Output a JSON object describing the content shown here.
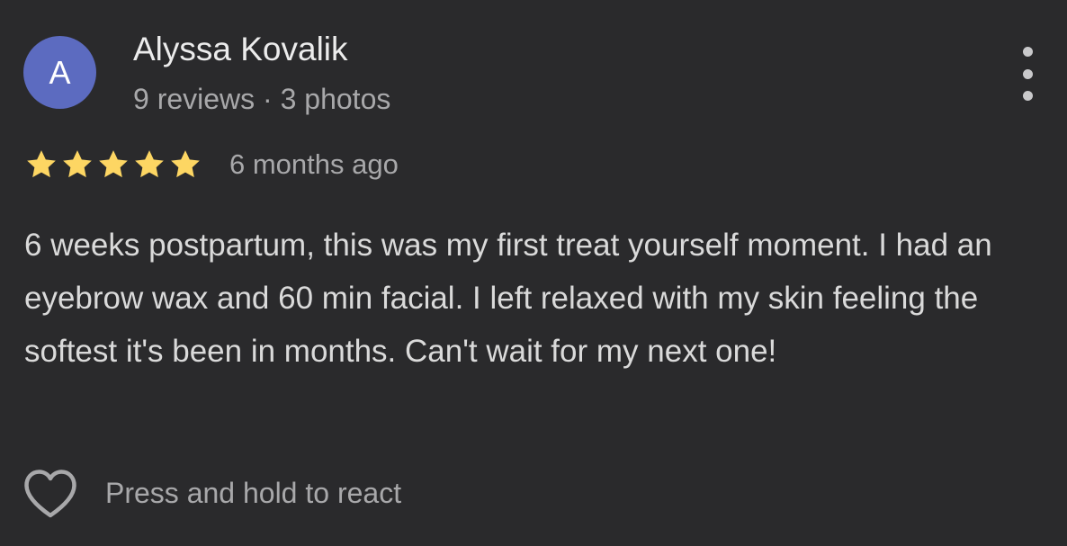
{
  "reviewer": {
    "avatar_letter": "A",
    "name": "Alyssa Kovalik",
    "meta": "9 reviews · 3 photos"
  },
  "rating": {
    "stars": 5,
    "max_stars": 5,
    "time_ago": "6 months ago"
  },
  "review": {
    "text": "6 weeks postpartum, this was my first treat yourself moment. I had an eyebrow wax and 60 min facial. I left relaxed with my skin feeling the softest it's been in months. Can't wait for my next one!"
  },
  "reaction": {
    "label": "Press and hold to react"
  },
  "icons": {
    "more": "more-vertical-icon",
    "star": "star-icon",
    "heart": "heart-outline-icon"
  },
  "colors": {
    "background": "#2a2a2c",
    "avatar": "#5c6bc0",
    "star": "#fdd663",
    "primary_text": "#ececec",
    "secondary_text": "#a8a8aa"
  }
}
